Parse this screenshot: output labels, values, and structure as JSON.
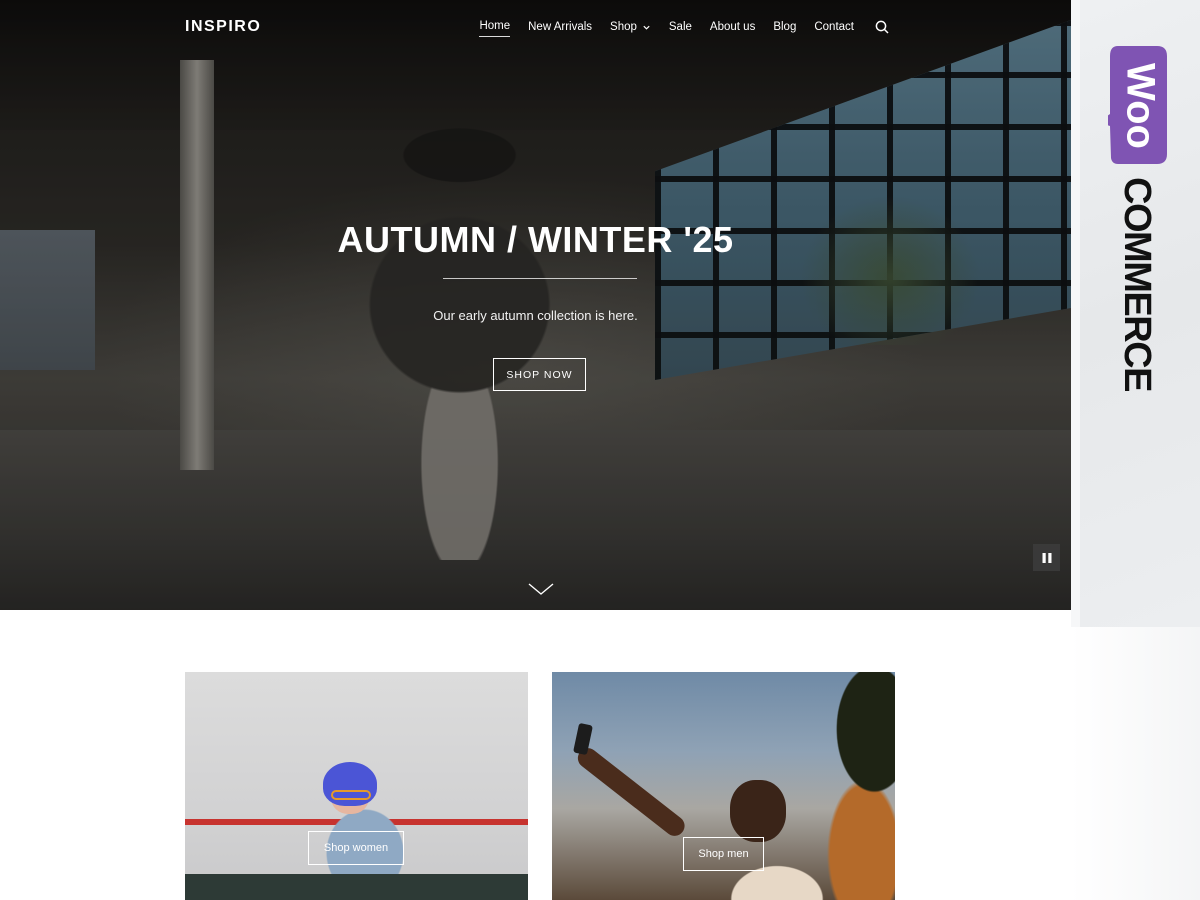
{
  "header": {
    "logo": "INSPIRO",
    "nav": [
      {
        "label": "Home",
        "active": true
      },
      {
        "label": "New Arrivals"
      },
      {
        "label": "Shop",
        "has_dropdown": true
      },
      {
        "label": "Sale"
      },
      {
        "label": "About us"
      },
      {
        "label": "Blog"
      },
      {
        "label": "Contact"
      }
    ],
    "search_icon": "search-icon"
  },
  "hero": {
    "title": "AUTUMN / WINTER '25",
    "subtitle": "Our early autumn collection is here.",
    "cta_label": "SHOP NOW",
    "pause_icon": "pause-icon",
    "scroll_icon": "chevron-down-icon"
  },
  "categories": [
    {
      "button_label": "Shop women"
    },
    {
      "button_label": "Shop men"
    }
  ],
  "woo_badge": {
    "top_text": "Woo",
    "bottom_text": "COMMERCE",
    "brand_color": "#7f54b3"
  }
}
